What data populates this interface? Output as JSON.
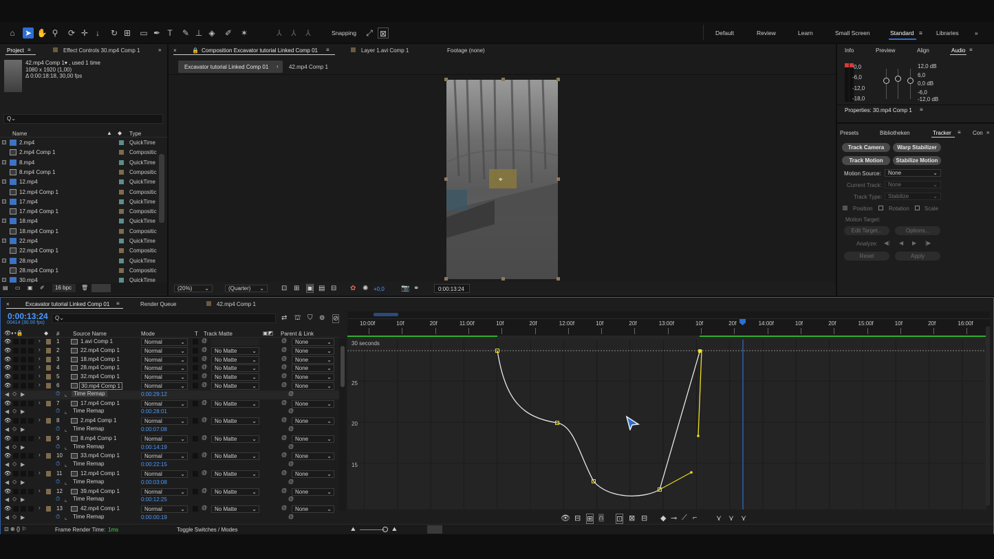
{
  "toolbar": {
    "snapping_label": "Snapping",
    "workspaces": [
      "Default",
      "Review",
      "Learn",
      "Small Screen",
      "Standard",
      "Libraries"
    ],
    "active_workspace": "Standard"
  },
  "project": {
    "tab_project": "Project",
    "tab_effect_controls": "Effect Controls 30.mp4 Comp 1",
    "info_name": "42.mp4 Comp 1▾ , used 1 time",
    "info_size": "1080 x 1920 (1,00)",
    "info_duration": "Δ 0:00:18:18, 30,00 fps",
    "search_placeholder": "Q⌄",
    "col_name": "Name",
    "col_type": "Type",
    "items": [
      {
        "name": "2.mp4",
        "type": "QuickTime"
      },
      {
        "name": "2.mp4 Comp 1",
        "type": "Compositic"
      },
      {
        "name": "8.mp4",
        "type": "QuickTime"
      },
      {
        "name": "8.mp4 Comp 1",
        "type": "Compositic"
      },
      {
        "name": "12.mp4",
        "type": "QuickTime"
      },
      {
        "name": "12.mp4 Comp 1",
        "type": "Compositic"
      },
      {
        "name": "17.mp4",
        "type": "QuickTime"
      },
      {
        "name": "17.mp4 Comp 1",
        "type": "Compositic"
      },
      {
        "name": "18.mp4",
        "type": "QuickTime"
      },
      {
        "name": "18.mp4 Comp 1",
        "type": "Compositic"
      },
      {
        "name": "22.mp4",
        "type": "QuickTime"
      },
      {
        "name": "22.mp4 Comp 1",
        "type": "Compositic"
      },
      {
        "name": "28.mp4",
        "type": "QuickTime"
      },
      {
        "name": "28.mp4 Comp 1",
        "type": "Compositic"
      },
      {
        "name": "30.mp4",
        "type": "QuickTime"
      }
    ],
    "bpc": "16 bpc"
  },
  "composition": {
    "tab_comp": "Composition Excavator tutorial Linked Comp 01",
    "tab_layer": "Layer 1.avi Comp 1",
    "tab_footage": "Footage (none)",
    "subtab_active": "Excavator tutorial Linked Comp 01",
    "subtab_other": "42.mp4 Comp 1",
    "zoom": "(20%)",
    "resolution": "(Quarter)",
    "exposure": "+0,0",
    "timecode": "0:00:13:24"
  },
  "right_panel": {
    "tabs_top": [
      "Info",
      "Preview",
      "Align",
      "Audio"
    ],
    "audio_levels_left": [
      "0,0",
      "-6,0",
      "-12,0",
      "-18,0"
    ],
    "audio_levels_right": [
      "12,0 dB",
      "6,0",
      "0,0 dB",
      "-6,0",
      "-12,0 dB"
    ],
    "properties_title": "Properties: 30.mp4 Comp 1",
    "tabs_mid": [
      "Presets",
      "Bibliotheken",
      "Tracker",
      "Con"
    ],
    "track_camera": "Track Camera",
    "warp_stabilizer": "Warp Stabilizer",
    "track_motion": "Track Motion",
    "stabilize_motion": "Stabilize Motion",
    "motion_source_label": "Motion Source:",
    "motion_source_value": "None",
    "current_track_label": "Current Track:",
    "current_track_value": "None",
    "track_type_label": "Track Type:",
    "track_type_value": "Stabilize",
    "position_label": "Position",
    "rotation_label": "Rotation",
    "scale_label": "Scale",
    "motion_target_label": "Motion Target:",
    "edit_target": "Edit Target...",
    "options": "Options...",
    "analyze_label": "Analyze:",
    "reset": "Reset",
    "apply": "Apply"
  },
  "timeline": {
    "tab_comp": "Excavator tutorial Linked Comp 01",
    "tab_render": "Render Queue",
    "tab_42": "42.mp4 Comp 1",
    "timecode": "0:00:13:24",
    "frames": "00414 (30.00 fps)",
    "col_source": "Source Name",
    "col_mode": "Mode",
    "col_t": "T",
    "col_matte": "Track Matte",
    "col_parent": "Parent & Link",
    "ruler": [
      "10:00f",
      "10f",
      "20f",
      "11:00f",
      "10f",
      "20f",
      "12:00f",
      "10f",
      "20f",
      "13:00f",
      "10f",
      "20f",
      "14:00f",
      "10f",
      "20f",
      "15:00f",
      "10f",
      "20f",
      "16:00f"
    ],
    "graph_label": "30 seconds",
    "graph_y": [
      "25",
      "20",
      "15"
    ],
    "rows": [
      {
        "kind": "layer",
        "num": "1",
        "name": "1.avi Comp 1",
        "mode": "Normal",
        "matte": "",
        "parent": "None"
      },
      {
        "kind": "layer",
        "num": "2",
        "name": "22.mp4 Comp 1",
        "mode": "Normal",
        "matte": "No Matte",
        "parent": "None"
      },
      {
        "kind": "layer",
        "num": "3",
        "name": "18.mp4 Comp 1",
        "mode": "Normal",
        "matte": "No Matte",
        "parent": "None"
      },
      {
        "kind": "layer",
        "num": "4",
        "name": "28.mp4 Comp 1",
        "mode": "Normal",
        "matte": "No Matte",
        "parent": "None"
      },
      {
        "kind": "layer",
        "num": "5",
        "name": "32.mp4 Comp 1",
        "mode": "Normal",
        "matte": "No Matte",
        "parent": "None"
      },
      {
        "kind": "layer",
        "num": "6",
        "name": "30.mp4 Comp 1",
        "mode": "Normal",
        "matte": "No Matte",
        "parent": "None",
        "selected": true
      },
      {
        "kind": "remap",
        "name": "Time Remap",
        "value": "0:00:29:12",
        "highlight": true
      },
      {
        "kind": "layer",
        "num": "7",
        "name": "17.mp4 Comp 1",
        "mode": "Normal",
        "matte": "No Matte",
        "parent": "None"
      },
      {
        "kind": "remap",
        "name": "Time Remap",
        "value": "0:00:28:01"
      },
      {
        "kind": "layer",
        "num": "8",
        "name": "2.mp4 Comp 1",
        "mode": "Normal",
        "matte": "No Matte",
        "parent": "None"
      },
      {
        "kind": "remap",
        "name": "Time Remap",
        "value": "0:00:07:08"
      },
      {
        "kind": "layer",
        "num": "9",
        "name": "8.mp4 Comp 1",
        "mode": "Normal",
        "matte": "No Matte",
        "parent": "None"
      },
      {
        "kind": "remap",
        "name": "Time Remap",
        "value": "0:00:14:19"
      },
      {
        "kind": "layer",
        "num": "10",
        "name": "33.mp4 Comp 1",
        "mode": "Normal",
        "matte": "No Matte",
        "parent": "None"
      },
      {
        "kind": "remap",
        "name": "Time Remap",
        "value": "0:00:22:15"
      },
      {
        "kind": "layer",
        "num": "11",
        "name": "12.mp4 Comp 1",
        "mode": "Normal",
        "matte": "No Matte",
        "parent": "None"
      },
      {
        "kind": "remap",
        "name": "Time Remap",
        "value": "0:00:03:08"
      },
      {
        "kind": "layer",
        "num": "12",
        "name": "39.mp4 Comp 1",
        "mode": "Normal",
        "matte": "No Matte",
        "parent": "None"
      },
      {
        "kind": "remap",
        "name": "Time Remap",
        "value": "0:00:12:25"
      },
      {
        "kind": "layer",
        "num": "13",
        "name": "42.mp4 Comp 1",
        "mode": "Normal",
        "matte": "No Matte",
        "parent": "None"
      },
      {
        "kind": "remap",
        "name": "Time Remap",
        "value": "0:00:00:19"
      }
    ],
    "frame_render_label": "Frame Render Time:",
    "frame_render_value": "1ms",
    "toggle_label": "Toggle Switches / Modes"
  },
  "colors": {
    "accent": "#2d6fd1",
    "timecode": "#4b9bff",
    "keyframe": "#f0e02a",
    "workarea": "#2fb12f"
  }
}
